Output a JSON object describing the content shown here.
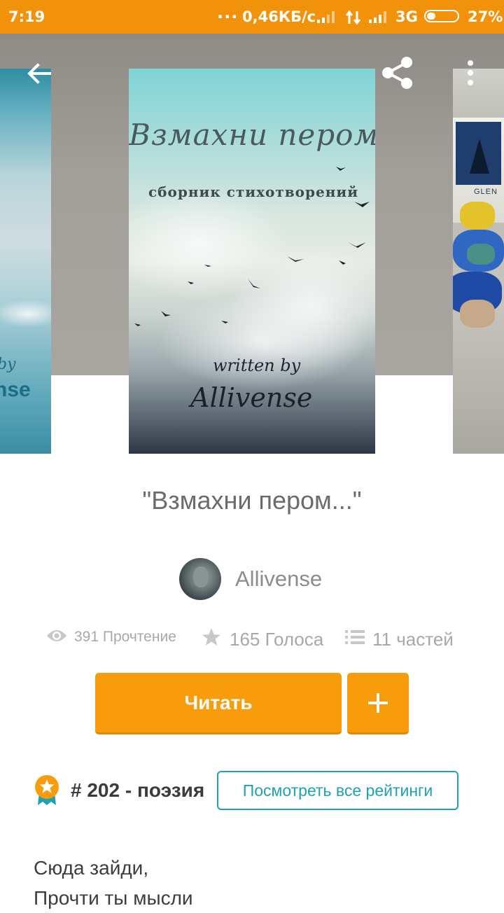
{
  "status_bar": {
    "time": "7:19",
    "dots": "...",
    "speed": "0,46КБ/с",
    "network": "3G",
    "battery": "27%",
    "battery_level": 0.27
  },
  "covers": {
    "left": {
      "line1": "by",
      "line2": "nse"
    },
    "main": {
      "title": "Взмахни пером...",
      "subtitle": "сборник стихотворений",
      "written_by": "written by",
      "author": "Allivense"
    },
    "right": {
      "label": "GLEN"
    }
  },
  "toolbar": {
    "back_icon": "arrow-left-icon",
    "share_icon": "share-icon",
    "more_icon": "more-vert-icon"
  },
  "story": {
    "title": "\"Взмахни пером...\"",
    "author": "Allivense",
    "stats": {
      "reads": "391 Прочтение",
      "votes": "165 Голоса",
      "parts": "11 частей"
    }
  },
  "actions": {
    "read_label": "Читать",
    "add_label": "+"
  },
  "ranking": {
    "text": "# 202 - поэзия",
    "button_label": "Посмотреть все рейтинги"
  },
  "description": {
    "line1": "Сюда зайди,",
    "line2": "Прочти ты мысли"
  },
  "colors": {
    "status_bar": "#f2910a",
    "accent": "#f99c0c",
    "link": "#1ea1b2"
  }
}
